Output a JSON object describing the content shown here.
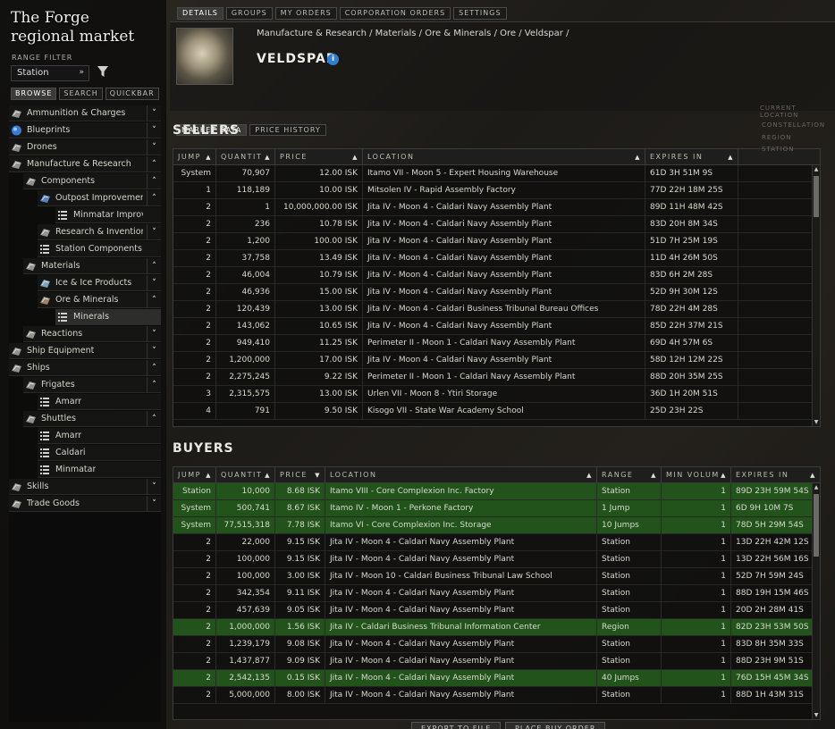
{
  "window": {
    "title": "The Forge regional market",
    "range_filter_label": "RANGE FILTER",
    "range_value": "Station"
  },
  "left_tabs": [
    "BROWSE",
    "SEARCH",
    "QUICKBAR"
  ],
  "tree": [
    {
      "label": "Ammunition & Charges",
      "icon": "ammo-icon",
      "exp": "down"
    },
    {
      "label": "Blueprints",
      "icon": "blueprint-icon",
      "exp": "down"
    },
    {
      "label": "Drones",
      "icon": "drone-icon",
      "exp": "down"
    },
    {
      "label": "Manufacture & Research",
      "icon": "industry-icon",
      "exp": "up"
    },
    {
      "label": "Components",
      "icon": "component-icon",
      "exp": "up"
    },
    {
      "label": "Outpost Improvement P",
      "icon": "outpost-icon",
      "exp": "up"
    },
    {
      "label": "Minmatar Improvem",
      "icon": "list-icon",
      "exp": ""
    },
    {
      "label": "Research & Invention",
      "icon": "research-icon",
      "exp": "down"
    },
    {
      "label": "Station Components",
      "icon": "list-icon",
      "exp": ""
    },
    {
      "label": "Materials",
      "icon": "materials-icon",
      "exp": "up"
    },
    {
      "label": "Ice & Ice Products",
      "icon": "ice-icon",
      "exp": "down"
    },
    {
      "label": "Ore & Minerals",
      "icon": "ore-icon",
      "exp": "up"
    },
    {
      "label": "Minerals",
      "icon": "list-icon",
      "exp": ""
    },
    {
      "label": "Reactions",
      "icon": "reaction-icon",
      "exp": "down"
    },
    {
      "label": "Ship Equipment",
      "icon": "equipment-icon",
      "exp": "down"
    },
    {
      "label": "Ships",
      "icon": "ship-icon",
      "exp": "up"
    },
    {
      "label": "Frigates",
      "icon": "ship-icon",
      "exp": "up"
    },
    {
      "label": "Amarr",
      "icon": "list-icon",
      "exp": ""
    },
    {
      "label": "Shuttles",
      "icon": "ship-icon",
      "exp": "up"
    },
    {
      "label": "Amarr",
      "icon": "list-icon",
      "exp": ""
    },
    {
      "label": "Caldari",
      "icon": "list-icon",
      "exp": ""
    },
    {
      "label": "Minmatar",
      "icon": "list-icon",
      "exp": ""
    },
    {
      "label": "Skills",
      "icon": "skill-icon",
      "exp": "down"
    },
    {
      "label": "Trade Goods",
      "icon": "trade-icon",
      "exp": "down"
    }
  ],
  "top_tabs": [
    "DETAILS",
    "GROUPS",
    "MY ORDERS",
    "CORPORATION ORDERS",
    "SETTINGS"
  ],
  "item": {
    "breadcrumb": "Manufacture & Research / Materials / Ore & Minerals / Ore / Veldspar /",
    "name": "VELDSPAR",
    "info_glyph": "i"
  },
  "market_tabs": [
    "MARKET DATA",
    "PRICE HISTORY"
  ],
  "sellers": {
    "title": "SELLERS",
    "columns": [
      "JUMP",
      "QUANTIT",
      "PRICE",
      "LOCATION",
      "EXPIRES IN"
    ],
    "rows": [
      [
        "System",
        "70,907",
        "12.00 ISK",
        "Itamo VII - Moon 5 - Expert Housing Warehouse",
        "61D 3H 51M 9S"
      ],
      [
        "1",
        "118,189",
        "10.00 ISK",
        "Mitsolen IV - Rapid Assembly Factory",
        "77D 22H 18M 25S"
      ],
      [
        "2",
        "1",
        "10,000,000.00 ISK",
        "Jita IV - Moon 4 - Caldari Navy Assembly Plant",
        "89D 11H 48M 42S"
      ],
      [
        "2",
        "236",
        "10.78 ISK",
        "Jita IV - Moon 4 - Caldari Navy Assembly Plant",
        "83D 20H 8M 34S"
      ],
      [
        "2",
        "1,200",
        "100.00 ISK",
        "Jita IV - Moon 4 - Caldari Navy Assembly Plant",
        "51D 7H 25M 19S"
      ],
      [
        "2",
        "37,758",
        "13.49 ISK",
        "Jita IV - Moon 4 - Caldari Navy Assembly Plant",
        "11D 4H 26M 50S"
      ],
      [
        "2",
        "46,004",
        "10.79 ISK",
        "Jita IV - Moon 4 - Caldari Navy Assembly Plant",
        "83D 6H 2M 28S"
      ],
      [
        "2",
        "46,936",
        "15.00 ISK",
        "Jita IV - Moon 4 - Caldari Navy Assembly Plant",
        "52D 9H 30M 12S"
      ],
      [
        "2",
        "120,439",
        "13.00 ISK",
        "Jita IV - Moon 4 - Caldari Business Tribunal Bureau Offices",
        "78D 22H 4M 28S"
      ],
      [
        "2",
        "143,062",
        "10.65 ISK",
        "Jita IV - Moon 4 - Caldari Navy Assembly Plant",
        "85D 22H 37M 21S"
      ],
      [
        "2",
        "949,410",
        "11.25 ISK",
        "Perimeter II - Moon 1 - Caldari Navy Assembly Plant",
        "69D 4H 57M 6S"
      ],
      [
        "2",
        "1,200,000",
        "17.00 ISK",
        "Jita IV - Moon 4 - Caldari Navy Assembly Plant",
        "58D 12H 12M 22S"
      ],
      [
        "2",
        "2,275,245",
        "9.22 ISK",
        "Perimeter II - Moon 1 - Caldari Navy Assembly Plant",
        "88D 20H 35M 25S"
      ],
      [
        "3",
        "2,315,575",
        "13.00 ISK",
        "Urlen VII - Moon 8 - Ytiri Storage",
        "36D 1H 20M 51S"
      ],
      [
        "4",
        "791",
        "9.50 ISK",
        "Kisogo VII - State War Academy School",
        "25D 23H 22S"
      ]
    ]
  },
  "buyers": {
    "title": "BUYERS",
    "columns": [
      "JUMP",
      "QUANTIT",
      "PRICE",
      "LOCATION",
      "RANGE",
      "MIN VOLUM",
      "EXPIRES IN"
    ],
    "rows": [
      {
        "c": [
          "Station",
          "10,000",
          "8.68 ISK",
          "Itamo VIII - Core Complexion Inc. Factory",
          "Station",
          "1",
          "89D 23H 59M 54S"
        ],
        "g": true
      },
      {
        "c": [
          "System",
          "500,741",
          "8.67 ISK",
          "Itamo IV - Moon 1 - Perkone Factory",
          "1 Jump",
          "1",
          "6D 9H 10M 7S"
        ],
        "g": true
      },
      {
        "c": [
          "System",
          "77,515,318",
          "7.78 ISK",
          "Itamo VI - Core Complexion Inc. Storage",
          "10 Jumps",
          "1",
          "78D 5H 29M 54S"
        ],
        "g": true
      },
      {
        "c": [
          "2",
          "22,000",
          "9.15 ISK",
          "Jita IV - Moon 4 - Caldari Navy Assembly Plant",
          "Station",
          "1",
          "13D 22H 42M 12S"
        ],
        "g": false
      },
      {
        "c": [
          "2",
          "100,000",
          "9.15 ISK",
          "Jita IV - Moon 4 - Caldari Navy Assembly Plant",
          "Station",
          "1",
          "13D 22H 56M 16S"
        ],
        "g": false
      },
      {
        "c": [
          "2",
          "100,000",
          "3.00 ISK",
          "Jita IV - Moon 10 - Caldari Business Tribunal Law School",
          "Station",
          "1",
          "52D 7H 59M 24S"
        ],
        "g": false
      },
      {
        "c": [
          "2",
          "342,354",
          "9.11 ISK",
          "Jita IV - Moon 4 - Caldari Navy Assembly Plant",
          "Station",
          "1",
          "88D 19H 15M 46S"
        ],
        "g": false
      },
      {
        "c": [
          "2",
          "457,639",
          "9.05 ISK",
          "Jita IV - Moon 4 - Caldari Navy Assembly Plant",
          "Station",
          "1",
          "20D 2H 28M 41S"
        ],
        "g": false
      },
      {
        "c": [
          "2",
          "1,000,000",
          "1.56 ISK",
          "Jita IV - Caldari Business Tribunal Information Center",
          "Region",
          "1",
          "82D 23H 53M 50S"
        ],
        "g": true
      },
      {
        "c": [
          "2",
          "1,239,179",
          "9.08 ISK",
          "Jita IV - Moon 4 - Caldari Navy Assembly Plant",
          "Station",
          "1",
          "83D 8H 35M 33S"
        ],
        "g": false
      },
      {
        "c": [
          "2",
          "1,437,877",
          "9.09 ISK",
          "Jita IV - Moon 4 - Caldari Navy Assembly Plant",
          "Station",
          "1",
          "88D 23H 9M 51S"
        ],
        "g": false
      },
      {
        "c": [
          "2",
          "2,542,135",
          "0.15 ISK",
          "Jita IV - Moon 4 - Caldari Navy Assembly Plant",
          "40 Jumps",
          "1",
          "76D 15H 45M 34S"
        ],
        "g": true
      },
      {
        "c": [
          "2",
          "5,000,000",
          "8.00 ISK",
          "Jita IV - Moon 4 - Caldari Navy Assembly Plant",
          "Station",
          "1",
          "88D 1H 43M 31S"
        ],
        "g": false
      }
    ]
  },
  "bottom_buttons": [
    "EXPORT TO FILE",
    "PLACE BUY ORDER"
  ],
  "side_panel": [
    "CURRENT LOCATION",
    "CONSTELLATION",
    "REGION",
    "STATION"
  ],
  "colors": {
    "green_row": "#2b6e20",
    "accent_blue": "#2f7fd8"
  }
}
